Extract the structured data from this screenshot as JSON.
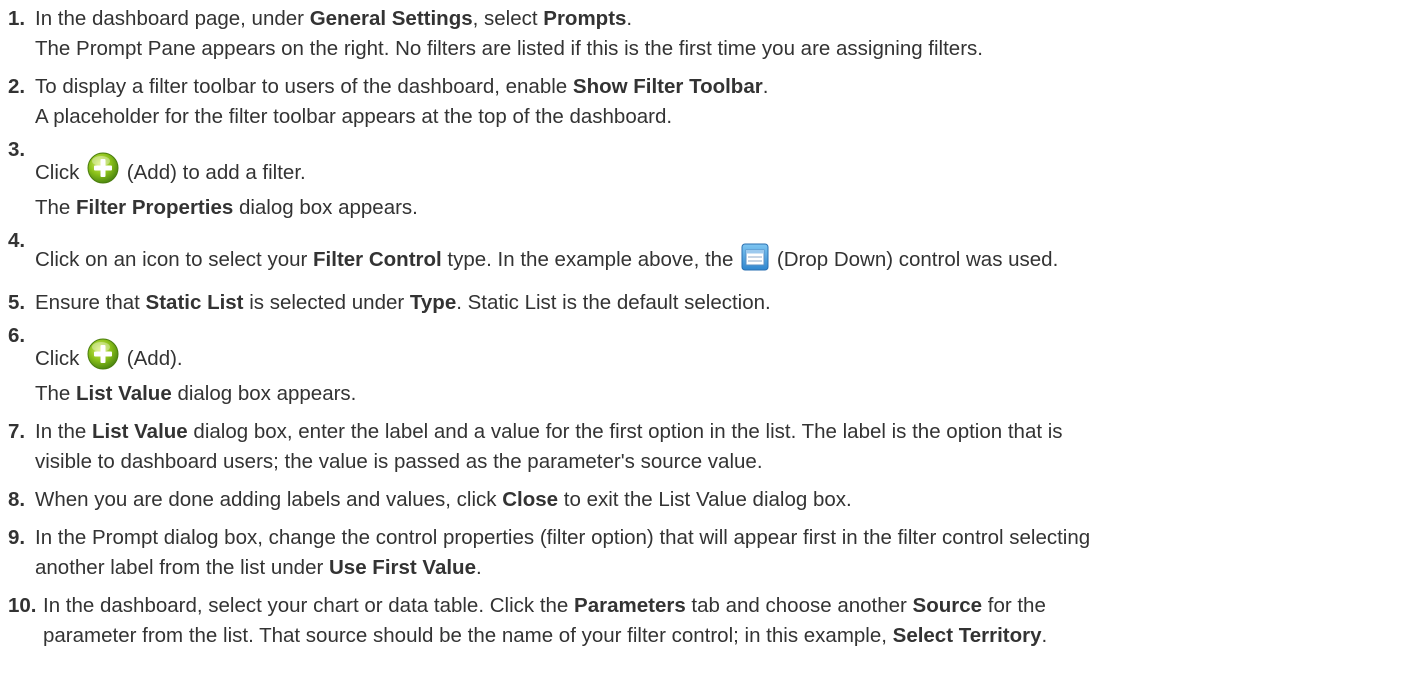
{
  "steps": [
    {
      "number": "1.",
      "lines": [
        [
          "In the dashboard page, under ",
          {
            "b": "General Settings"
          },
          ", select ",
          {
            "b": "Prompts"
          },
          "."
        ],
        [
          "The Prompt Pane appears on the right. No filters are listed if this is the first time you are assigning filters."
        ]
      ]
    },
    {
      "number": "2.",
      "lines": [
        [
          "To display a filter toolbar to users of the dashboard, enable ",
          {
            "b": "Show Filter Toolbar"
          },
          "."
        ],
        [
          "A placeholder for the filter toolbar appears at the top of the dashboard."
        ]
      ]
    },
    {
      "number": "3.",
      "tall": true,
      "lines": [
        [
          "Click ",
          {
            "icon": "add-icon"
          },
          " (Add) to add a filter."
        ],
        [
          "The ",
          {
            "b": "Filter Properties"
          },
          " dialog box appears."
        ]
      ]
    },
    {
      "number": "4.",
      "tall": true,
      "lines": [
        [
          "Click on an icon to select your ",
          {
            "b": "Filter Control"
          },
          " type. In the example above, the ",
          {
            "icon": "dropdown-control-icon"
          },
          " (Drop Down) control was used."
        ]
      ]
    },
    {
      "number": "5.",
      "lines": [
        [
          "Ensure that ",
          {
            "b": "Static List"
          },
          " is selected under ",
          {
            "b": "Type"
          },
          ". Static List is the default selection."
        ]
      ]
    },
    {
      "number": "6.",
      "tall": true,
      "lines": [
        [
          "Click ",
          {
            "icon": "add-icon"
          },
          " (Add)."
        ],
        [
          "The ",
          {
            "b": "List Value"
          },
          " dialog box appears."
        ]
      ]
    },
    {
      "number": "7.",
      "lines": [
        [
          "In the ",
          {
            "b": "List Value"
          },
          " dialog box, enter the label and a value for the first option in the list. The label is the option that is"
        ],
        [
          "visible to dashboard users; the value is passed as the parameter's source value."
        ]
      ]
    },
    {
      "number": "8.",
      "lines": [
        [
          "When you are done adding labels and values, click ",
          {
            "b": "Close"
          },
          " to exit the List Value dialog box."
        ]
      ]
    },
    {
      "number": "9.",
      "lines": [
        [
          "In the Prompt dialog box, change the control properties (filter option) that will appear first in the filter control selecting"
        ],
        [
          "another label from the list under ",
          {
            "b": "Use First Value"
          },
          "."
        ]
      ]
    },
    {
      "number": "10.",
      "lines": [
        [
          "In the dashboard, select your chart or data table. Click the ",
          {
            "b": "Parameters"
          },
          " tab and choose another ",
          {
            "b": "Source"
          },
          " for the"
        ],
        [
          "parameter from the list. That source should be the name of your filter control; in this example, ",
          {
            "b": "Select Territory"
          },
          "."
        ]
      ]
    }
  ]
}
